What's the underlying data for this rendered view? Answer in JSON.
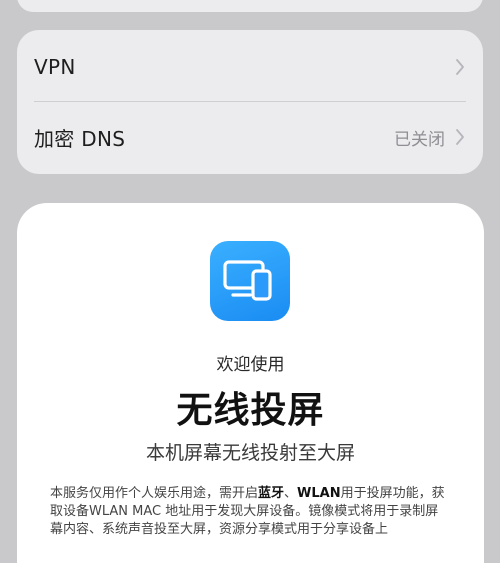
{
  "settings": {
    "rows": [
      {
        "label": "VPN",
        "value": ""
      },
      {
        "label": "加密 DNS",
        "value": "已关闭"
      }
    ]
  },
  "dialog": {
    "icon": "screen-cast-icon",
    "welcome": "欢迎使用",
    "title": "无线投屏",
    "subtitle": "本机屏幕无线投射至大屏",
    "description": {
      "part1": "本服务仅用作个人娱乐用途，需开启",
      "bluetooth": "蓝牙",
      "sep": "、",
      "wlan": "WLAN",
      "part2": "用于投屏功能，获取设备WLAN MAC 地址用于发现大屏设备。镜像模式将用于录制屏幕内容、系统声音投至大屏，资源分享模式用于分享设备上"
    },
    "accent_color": "#1a8cf3"
  }
}
